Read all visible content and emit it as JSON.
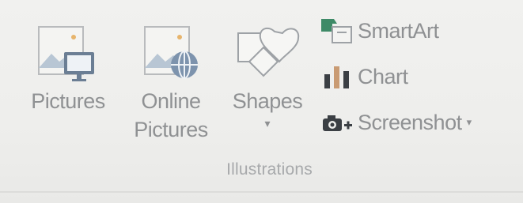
{
  "group": {
    "label": "Illustrations",
    "buttons": [
      {
        "label": "Pictures",
        "icon": "picture-monitor-icon"
      },
      {
        "label_line1": "Online",
        "label_line2": "Pictures",
        "icon": "online-pictures-icon"
      },
      {
        "label": "Shapes",
        "icon": "shapes-icon",
        "has_dropdown": true
      }
    ],
    "small_buttons": [
      {
        "label": "SmartArt",
        "icon": "smartart-icon"
      },
      {
        "label": "Chart",
        "icon": "chart-icon"
      },
      {
        "label": "Screenshot",
        "icon": "screenshot-camera-icon",
        "has_dropdown": true
      }
    ]
  },
  "colors": {
    "text": "#8f9193",
    "background": "#efefed",
    "accent_green": "#3e8a67",
    "icon_blue": "#6d8fb7"
  }
}
